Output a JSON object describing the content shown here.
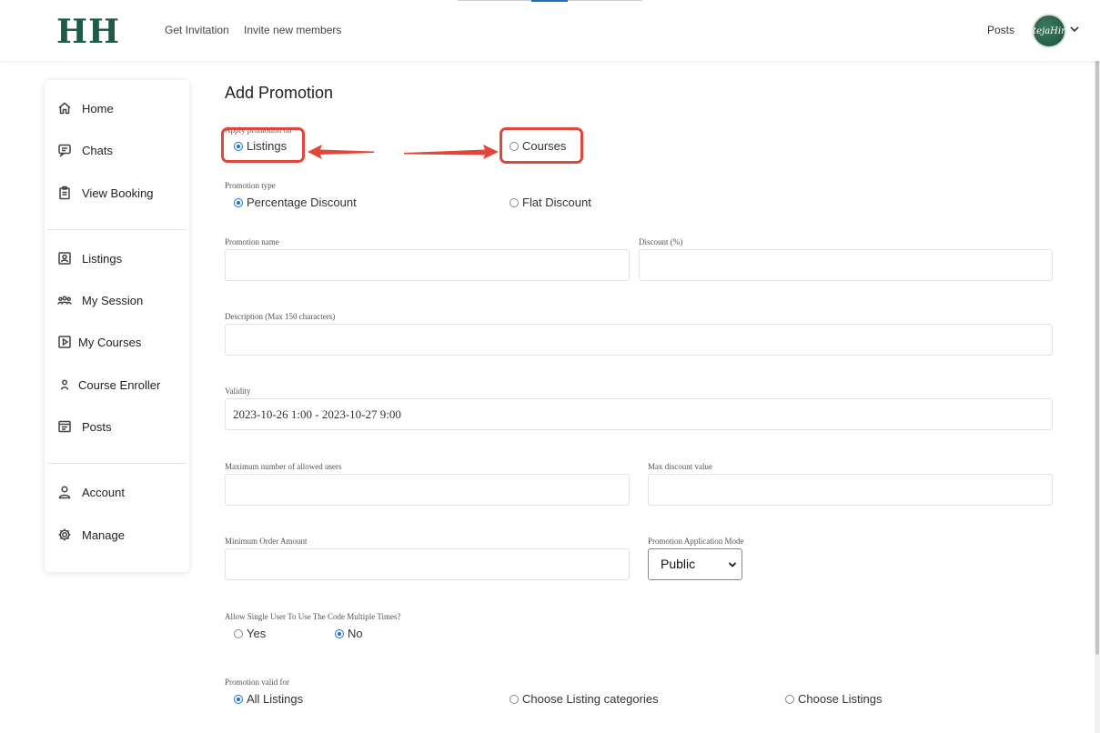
{
  "header": {
    "logo": "HH",
    "nav": [
      "Get Invitation",
      "Invite new members"
    ],
    "posts_link": "Posts",
    "avatar_text": "tejaHir"
  },
  "sidebar": {
    "group1": [
      "Home",
      "Chats",
      "View Booking"
    ],
    "group2": [
      "Listings",
      "My Session",
      "My Courses",
      "Course Enroller",
      "Posts"
    ],
    "group3": [
      "Account",
      "Manage"
    ]
  },
  "form": {
    "title": "Add Promotion",
    "apply_on": {
      "label": "Apply promotion on",
      "options": [
        "Listings",
        "Courses"
      ],
      "selected": "Listings"
    },
    "promo_type": {
      "label": "Promotion type",
      "options": [
        "Percentage Discount",
        "Flat Discount"
      ],
      "selected": "Percentage Discount"
    },
    "promo_name": {
      "label": "Promotion name",
      "value": ""
    },
    "discount": {
      "label": "Discount (%)",
      "value": ""
    },
    "description": {
      "label": "Description (Max 150 characters)",
      "value": ""
    },
    "validity": {
      "label": "Validity",
      "value": "2023-10-26 1:00 - 2023-10-27 9:00"
    },
    "max_users": {
      "label": "Maximum number of allowed users",
      "value": ""
    },
    "max_discount": {
      "label": "Max discount value",
      "value": ""
    },
    "min_order": {
      "label": "Minimum Order Amount",
      "value": ""
    },
    "mode": {
      "label": "Promotion Application Mode",
      "selected": "Public"
    },
    "multi_use": {
      "label": "Allow Single User To Use The Code Multiple Times?",
      "options": [
        "Yes",
        "No"
      ],
      "selected": "No"
    },
    "valid_for": {
      "label": "Promotion valid for",
      "options": [
        "All Listings",
        "Choose Listing categories",
        "Choose Listings"
      ],
      "selected": "All Listings"
    }
  },
  "colors": {
    "brand": "#1e5c45",
    "highlight": "#e0473a",
    "radio_selected": "#1f6fd0"
  }
}
